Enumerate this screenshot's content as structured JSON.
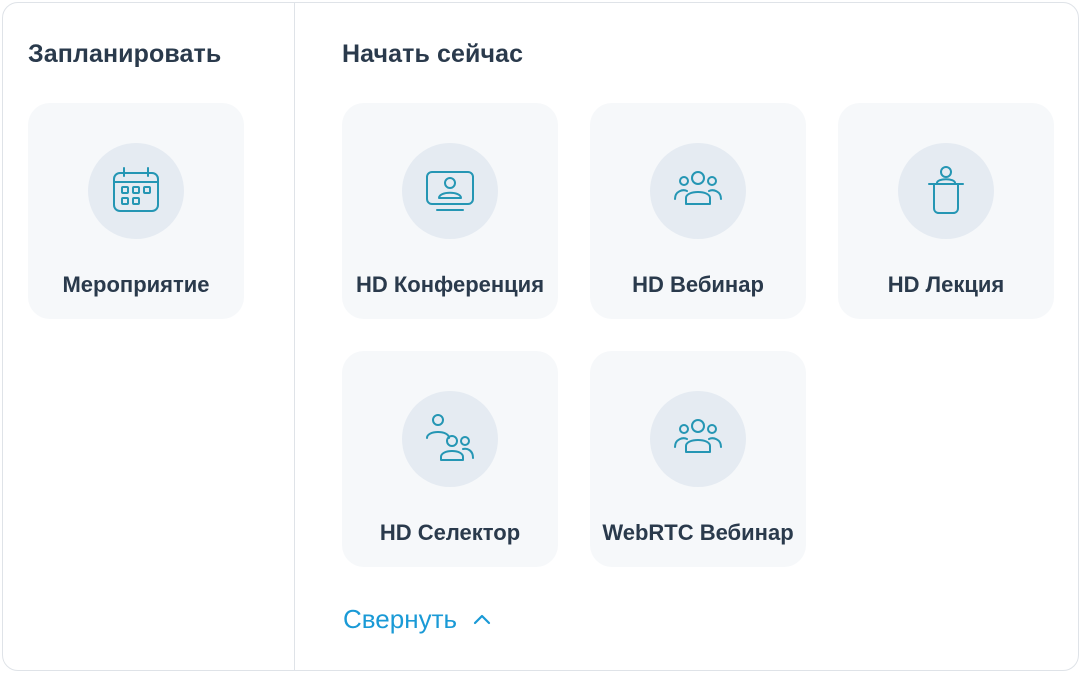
{
  "schedule": {
    "title": "Запланировать",
    "items": [
      {
        "label": "Мероприятие",
        "icon": "calendar-icon"
      }
    ]
  },
  "start_now": {
    "title": "Начать сейчас",
    "items": [
      {
        "label": "HD Конференция",
        "icon": "monitor-user-icon"
      },
      {
        "label": "HD Вебинар",
        "icon": "audience-icon"
      },
      {
        "label": "HD Лекция",
        "icon": "lectern-icon"
      },
      {
        "label": "HD Селектор",
        "icon": "selector-group-icon"
      },
      {
        "label": "WebRTC Вебинар",
        "icon": "audience-icon"
      }
    ]
  },
  "collapse": {
    "label": "Свернуть",
    "icon": "chevron-up-icon"
  },
  "colors": {
    "accent": "#1a9ad6",
    "icon_stroke": "#2596b4",
    "text": "#2a3a4c",
    "card_bg": "#f6f8fa",
    "circle_bg": "#e5ebf2"
  }
}
